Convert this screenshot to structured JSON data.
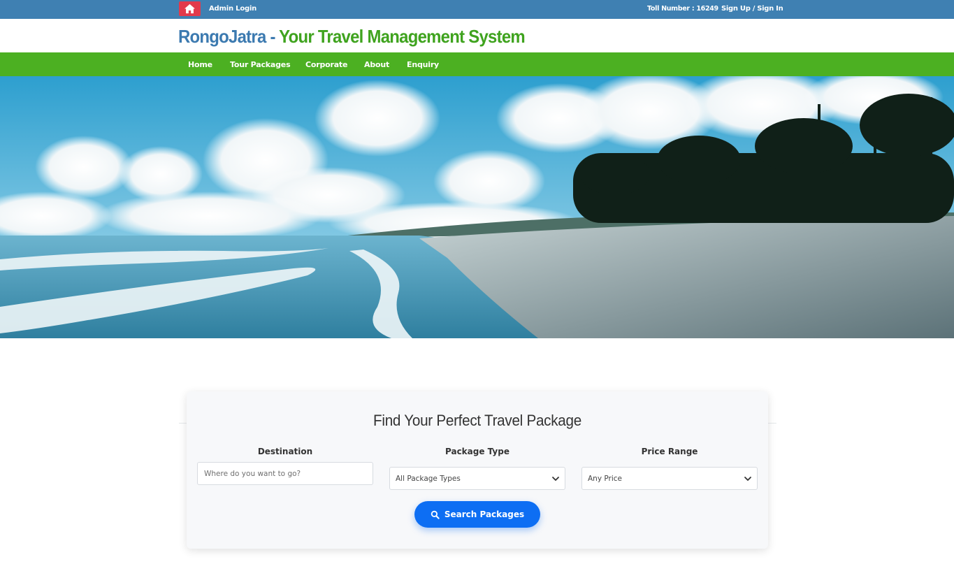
{
  "topbar": {
    "home_icon": "home-icon",
    "admin_login": "Admin Login",
    "toll_number": "Toll Number : 16249",
    "signup": "Sign Up / Sign In"
  },
  "logo": {
    "brand": "RongoJatra",
    "separator": " - ",
    "tagline": "Your Travel Management System"
  },
  "nav": {
    "items": [
      {
        "label": "Home"
      },
      {
        "label": "Tour Packages"
      },
      {
        "label": "Corporate"
      },
      {
        "label": "About"
      },
      {
        "label": "Enquiry"
      }
    ]
  },
  "hero": {
    "image": "beach-banner-image"
  },
  "search": {
    "title": "Find Your Perfect Travel Package",
    "destination": {
      "label": "Destination",
      "value": "",
      "placeholder": "Where do you want to go?"
    },
    "package_type": {
      "label": "Package Type",
      "selected": "All Package Types"
    },
    "price_range": {
      "label": "Price Range",
      "selected": "Any Price"
    },
    "button_label": "Search Packages",
    "button_icon": "search-icon"
  },
  "colors": {
    "topbar": "#3f80b2",
    "home_button": "#e23a4c",
    "brand_blue": "#3c7ab0",
    "brand_green": "#3fa31e",
    "navbar": "#4cb022",
    "search_button": "#0d6ef3"
  }
}
